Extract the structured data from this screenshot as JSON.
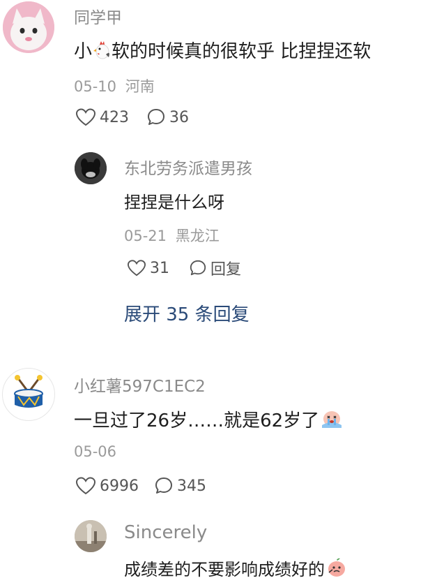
{
  "comments": [
    {
      "username": "同学甲",
      "text_before": "小",
      "text_after": "软的时候真的很软乎 比捏捏还软",
      "inline_icon": "rooster-emoji",
      "date": "05-10",
      "location": "河南",
      "likes": "423",
      "replies": "36",
      "avatar": "pink-cat-avatar",
      "reply": {
        "username": "东北劳务派遣男孩",
        "text": "捏捏是什么呀",
        "date": "05-21",
        "location": "黑龙江",
        "likes": "31",
        "reply_label": "回复",
        "avatar": "dark-dog-avatar"
      },
      "expand_label": "展开 35 条回复"
    },
    {
      "username": "小红薯597C1EC2",
      "text": "一旦过了26岁……就是62岁了",
      "inline_icon": "crying-emoji",
      "date": "05-06",
      "likes": "6996",
      "replies": "345",
      "avatar": "drum-avatar",
      "reply": {
        "username": "Sincerely",
        "text": "成绩差的不要影响成绩好的",
        "inline_icon": "peach-face-emoji",
        "avatar": "photo-avatar"
      }
    }
  ],
  "colors": {
    "username": "#8a8a8a",
    "meta": "#9a9a9a",
    "text": "#1e1e1e",
    "expand_link": "#2a4a78",
    "icon": "#555555"
  }
}
